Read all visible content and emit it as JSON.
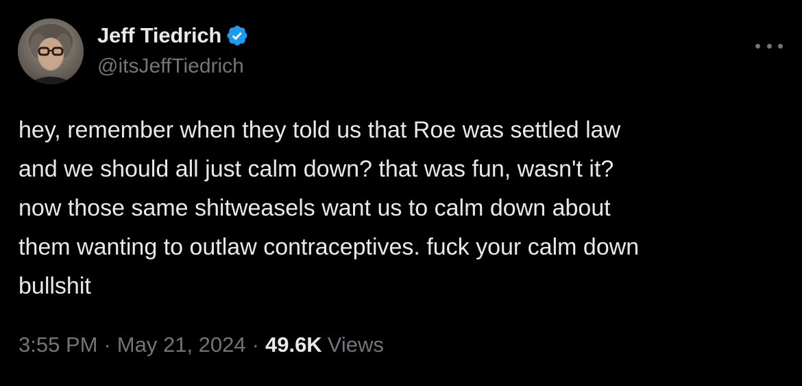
{
  "author": {
    "display_name": "Jeff Tiedrich",
    "handle": "@itsJeffTiedrich",
    "verified": true
  },
  "tweet": {
    "text_lines": [
      "hey, remember when they told us that Roe was settled law",
      "and we should all just calm down? that was fun, wasn't it?",
      "now those same shitweasels want us to calm down about",
      "them wanting to outlaw contraceptives. fuck your calm down",
      "bullshit"
    ],
    "time": "3:55 PM",
    "separator": "·",
    "date": "May 21, 2024",
    "views_count": "49.6K",
    "views_label": "Views"
  },
  "icons": {
    "verified": "verified-badge-icon",
    "more": "more-horizontal-icon"
  },
  "colors": {
    "background": "#000000",
    "text_primary": "#e7e9ea",
    "text_secondary": "#71767b",
    "verified_blue": "#1d9bf0"
  }
}
